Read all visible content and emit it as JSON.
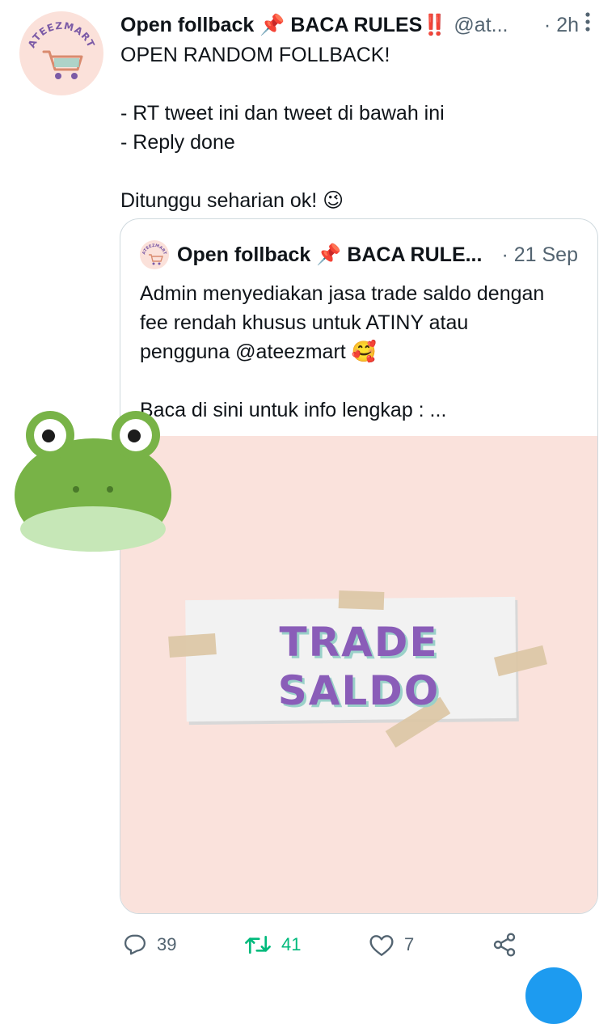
{
  "tweet": {
    "author_name": "Open follback 📌 BACA RULES‼️",
    "handle": "@at...",
    "separator": "·",
    "time": "2h",
    "text_lines": [
      "OPEN RANDOM FOLLBACK!",
      "",
      "- RT tweet ini dan tweet di bawah ini",
      "- Reply done",
      "",
      "Ditunggu seharian ok! 😉"
    ],
    "avatar_text": "ATEEZMART",
    "icons": {
      "avatar": "shopping-cart-icon",
      "more": "more-vertical-icon"
    }
  },
  "quote": {
    "author_name": "Open follback 📌 BACA RULE...",
    "time": "· 21 Sep",
    "text_lines": [
      "Admin menyediakan jasa trade saldo dengan",
      "fee rendah khusus untuk ATINY atau",
      "pengguna @ateezmart 🥰",
      "",
      "Baca di sini untuk info lengkap : ..."
    ],
    "avatar_text": "ATEEZMART",
    "media": {
      "line1": "TRADE",
      "line2": "SALDO"
    }
  },
  "actions": {
    "reply_count": "39",
    "retweet_count": "41",
    "like_count": "7",
    "icons": [
      "reply-icon",
      "retweet-icon",
      "like-icon",
      "share-icon"
    ]
  },
  "colors": {
    "text": "#0f1419",
    "secondary": "#536471",
    "retweet_active": "#00ba7c",
    "media_bg": "#fae2dc",
    "trade_text": "#8a5db8",
    "accent": "#1d9bf0"
  }
}
